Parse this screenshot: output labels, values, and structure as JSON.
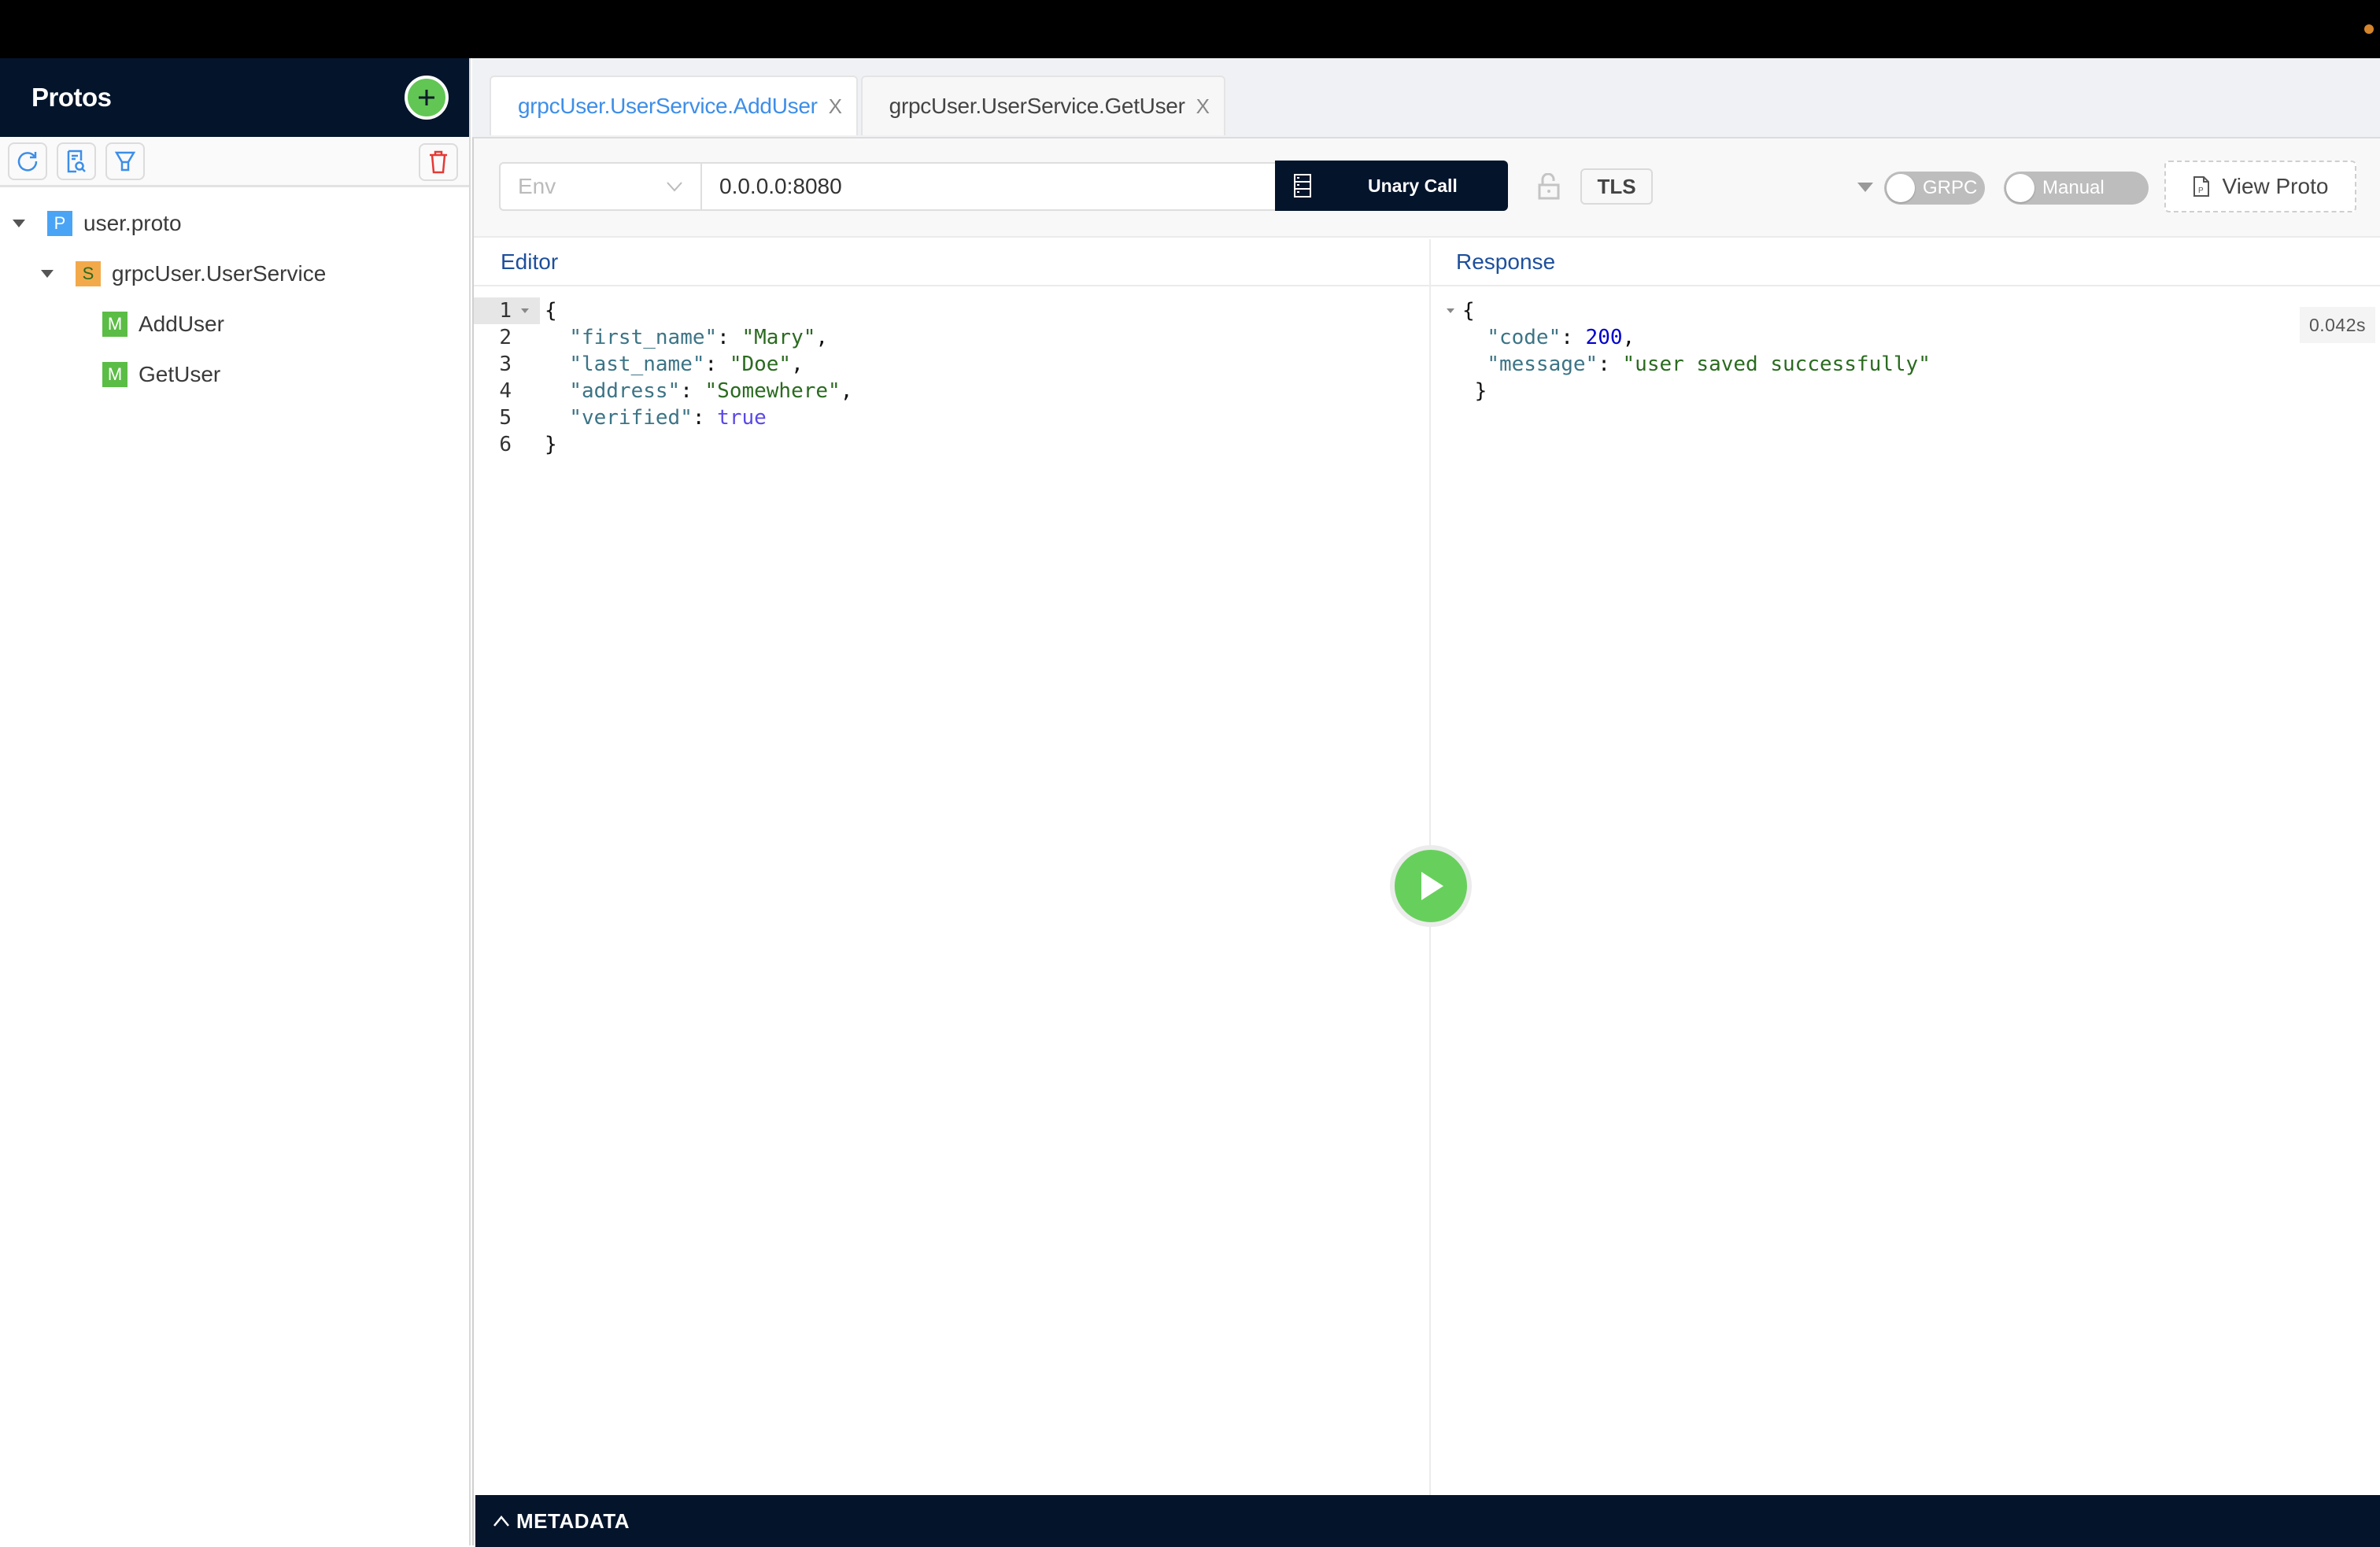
{
  "colors": {
    "navy": "#04142b",
    "accent_blue": "#3d8ee8",
    "green": "#62c654",
    "proto_badge": "#4aa4f5",
    "service_badge": "#f2a94a",
    "method_badge": "#5bbd45",
    "delete_red": "#e53935",
    "status_dot": "#d5852b"
  },
  "sidebar": {
    "title": "Protos",
    "add_icon": "plus-icon",
    "toolbar": [
      {
        "icon": "reload-icon",
        "label": "Reload"
      },
      {
        "icon": "file-search-icon",
        "label": "Search"
      },
      {
        "icon": "filter-icon",
        "label": "Filter"
      },
      {
        "icon": "delete-icon",
        "label": "Delete"
      }
    ],
    "tree": {
      "proto": {
        "badge": "P",
        "label": "user.proto"
      },
      "service": {
        "badge": "S",
        "label": "grpcUser.UserService"
      },
      "methods": [
        {
          "badge": "M",
          "label": "AddUser"
        },
        {
          "badge": "M",
          "label": "GetUser"
        }
      ]
    }
  },
  "tabs": [
    {
      "label": "grpcUser.UserService.AddUser",
      "close": "X",
      "active": true
    },
    {
      "label": "grpcUser.UserService.GetUser",
      "close": "X",
      "active": false
    }
  ],
  "request_bar": {
    "env_placeholder": "Env",
    "url": "0.0.0.0:8080",
    "call_type": "Unary Call",
    "tls_label": "TLS",
    "grpc_toggle": "GRPC",
    "manual_toggle": "Manual",
    "view_proto": "View Proto"
  },
  "editor": {
    "title": "Editor",
    "line_numbers": [
      "1",
      "2",
      "3",
      "4",
      "5",
      "6"
    ],
    "lines": [
      {
        "open": "{"
      },
      {
        "key": "\"first_name\"",
        "sep": ": ",
        "val": "\"Mary\"",
        "type": "s",
        "end": ","
      },
      {
        "key": "\"last_name\"",
        "sep": ": ",
        "val": "\"Doe\"",
        "type": "s",
        "end": ","
      },
      {
        "key": "\"address\"",
        "sep": ": ",
        "val": "\"Somewhere\"",
        "type": "s",
        "end": ","
      },
      {
        "key": "\"verified\"",
        "sep": ": ",
        "val": "true",
        "type": "b",
        "end": ""
      },
      {
        "open": "}"
      }
    ]
  },
  "response": {
    "title": "Response",
    "time": "0.042s",
    "lines": [
      {
        "open": "{"
      },
      {
        "key": "\"code\"",
        "sep": ": ",
        "val": "200",
        "type": "n",
        "end": ","
      },
      {
        "key": "\"message\"",
        "sep": ": ",
        "val": "\"user saved successfully\"",
        "type": "s",
        "end": ""
      },
      {
        "open": " }"
      }
    ]
  },
  "metadata": {
    "label": "METADATA",
    "chevron": "^"
  }
}
